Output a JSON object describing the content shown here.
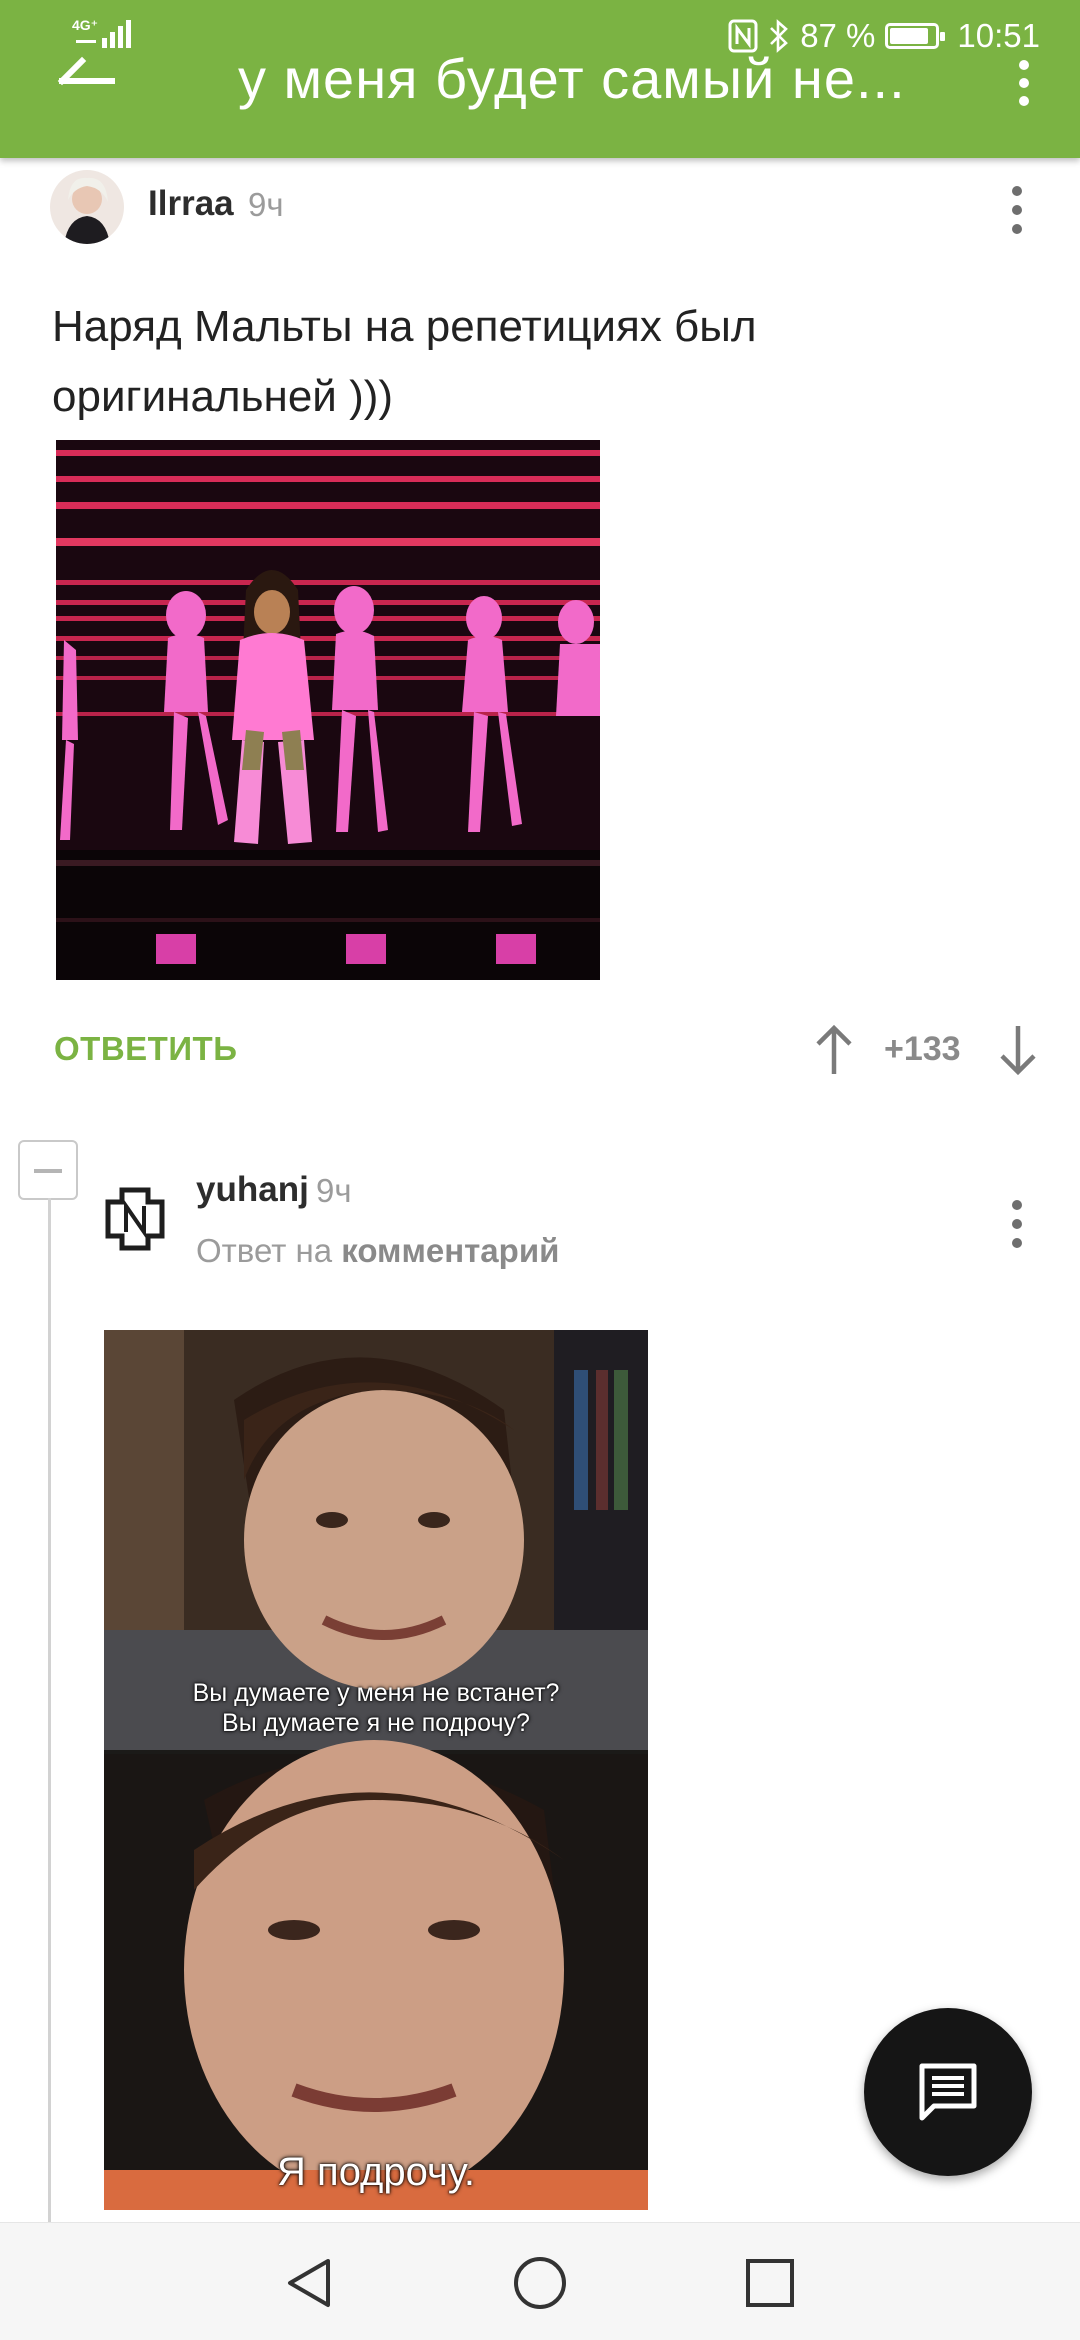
{
  "status_bar": {
    "network": "4G⁺",
    "battery": "87 %",
    "battery_level": 0.87,
    "time": "10:51"
  },
  "toolbar": {
    "title": "у меня будет самый не...",
    "accent_color": "#7bb343",
    "back_icon": "arrow-left-icon",
    "more_icon": "more-vertical-icon"
  },
  "comments": [
    {
      "author": "Ilrraa",
      "time": "9ч",
      "text": "Наряд Мальты на репетициях был оригинальней )))",
      "reply_label": "ОТВЕТИТЬ",
      "rating": "+133",
      "icons": {
        "up": "arrow-up-icon",
        "down": "arrow-down-icon",
        "more": "more-vertical-icon"
      }
    },
    {
      "author": "yuhanj",
      "time": "9ч",
      "reply_to_prefix": "Ответ на",
      "reply_to_link": "комментарий",
      "image_caption_top": [
        "Вы думаете у меня не встанет?",
        "Вы думаете я не подрочу?"
      ],
      "image_caption_bottom": "Я подрочу."
    }
  ],
  "fab": {
    "icon": "comment-icon"
  },
  "nav": {
    "back_icon": "nav-back-icon",
    "home_icon": "nav-home-icon",
    "recents_icon": "nav-recents-icon"
  }
}
